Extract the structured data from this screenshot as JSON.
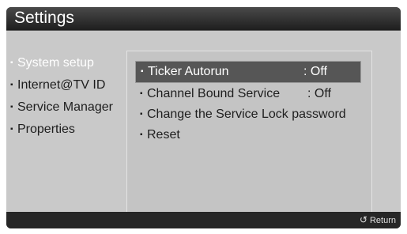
{
  "header": {
    "title": "Settings"
  },
  "menu": {
    "bullet": "▪",
    "items": [
      {
        "label": "System setup"
      },
      {
        "label": "Internet@TV ID"
      },
      {
        "label": "Service Manager"
      },
      {
        "label": "Properties"
      }
    ]
  },
  "options": {
    "bullet": "▪",
    "rows": [
      {
        "label": "Ticker Autorun",
        "value": ": Off"
      },
      {
        "label": "Channel Bound Service",
        "value": ": Off"
      },
      {
        "label": "Change the Service Lock password"
      },
      {
        "label": "Reset"
      }
    ]
  },
  "footer": {
    "return_label": "Return",
    "return_icon": "↺"
  }
}
